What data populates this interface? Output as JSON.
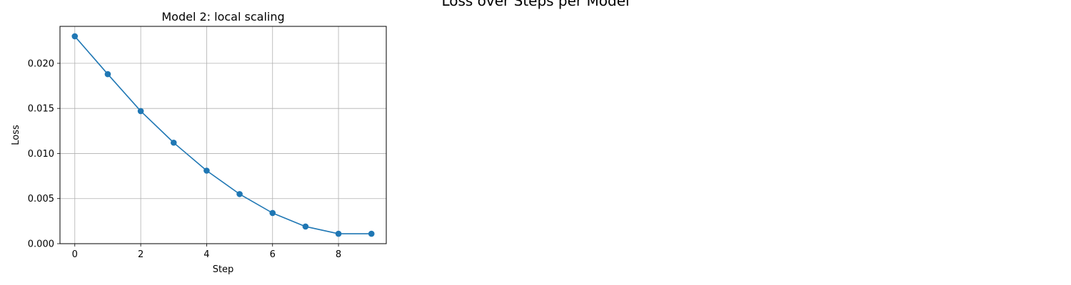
{
  "figure": {
    "suptitle": "Loss over Steps per Model"
  },
  "chart_data": {
    "type": "line",
    "title": "Model 2: local scaling",
    "xlabel": "Step",
    "ylabel": "Loss",
    "xlim": [
      -0.45,
      9.45
    ],
    "ylim": [
      0,
      0.0241
    ],
    "xticks": [
      0,
      2,
      4,
      6,
      8
    ],
    "xtick_labels": [
      "0",
      "2",
      "4",
      "6",
      "8"
    ],
    "yticks": [
      0,
      0.005,
      0.01,
      0.015,
      0.02
    ],
    "ytick_labels": [
      "0.000",
      "0.005",
      "0.010",
      "0.015",
      "0.020"
    ],
    "grid": true,
    "markers": true,
    "color": "#1f77b4",
    "x": [
      0,
      1,
      2,
      3,
      4,
      5,
      6,
      7,
      8,
      9
    ],
    "y": [
      0.023,
      0.0188,
      0.0147,
      0.0112,
      0.0081,
      0.0055,
      0.0034,
      0.0019,
      0.0011,
      0.0011
    ]
  }
}
